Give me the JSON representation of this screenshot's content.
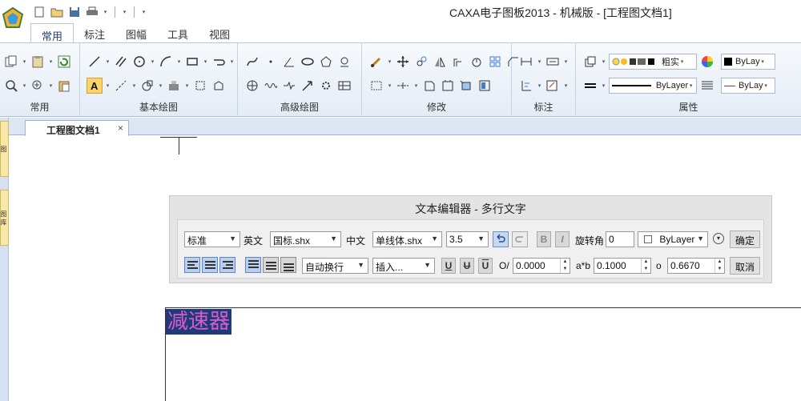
{
  "window": {
    "title": "CAXA电子图板2013 - 机械版 - [工程图文档1]"
  },
  "tabs": [
    {
      "label": "常用"
    },
    {
      "label": "标注"
    },
    {
      "label": "图幅"
    },
    {
      "label": "工具"
    },
    {
      "label": "视图"
    }
  ],
  "ribbon": {
    "groups": [
      {
        "label": "常用"
      },
      {
        "label": "基本绘图"
      },
      {
        "label": "高级绘图"
      },
      {
        "label": "修改"
      },
      {
        "label": "标注"
      },
      {
        "label": "属性"
      }
    ],
    "properties": {
      "layer_state": "粗实",
      "color_top": "ByLay",
      "linetype": "ByLayer",
      "color_bottom": "ByLay"
    }
  },
  "left_dock": {
    "tab1": "图",
    "tab2": "图 库"
  },
  "document": {
    "tab_label": "工程图文档1",
    "close_glyph": "×"
  },
  "text_editor": {
    "title": "文本编辑器 - 多行文字",
    "style_value": "标准",
    "english_label": "英文",
    "english_font": "国标.shx",
    "chinese_label": "中文",
    "chinese_font": "单线体.shx",
    "height_value": "3.5",
    "bold_glyph": "B",
    "italic_glyph": "I",
    "rotation_label": "旋转角",
    "rotation_value": "0",
    "color_value": "ByLayer",
    "ok_label": "确定",
    "wrap_value": "自动换行",
    "insert_value": "插入...",
    "underline_glyph": "U",
    "strike_glyph": "U",
    "overline_glyph": "U",
    "oblique_label": "O/",
    "oblique_value": "0.0000",
    "spacing_label": "a*b",
    "spacing_value": "0.1000",
    "width_label": "o",
    "width_value": "0.6670",
    "cancel_label": "取消"
  },
  "drawing": {
    "selected_text": "减速器"
  },
  "colors": {
    "accent": "#1f3f7a",
    "selection_bg": "#1e3a7b",
    "selection_text": "#d95bc8"
  }
}
